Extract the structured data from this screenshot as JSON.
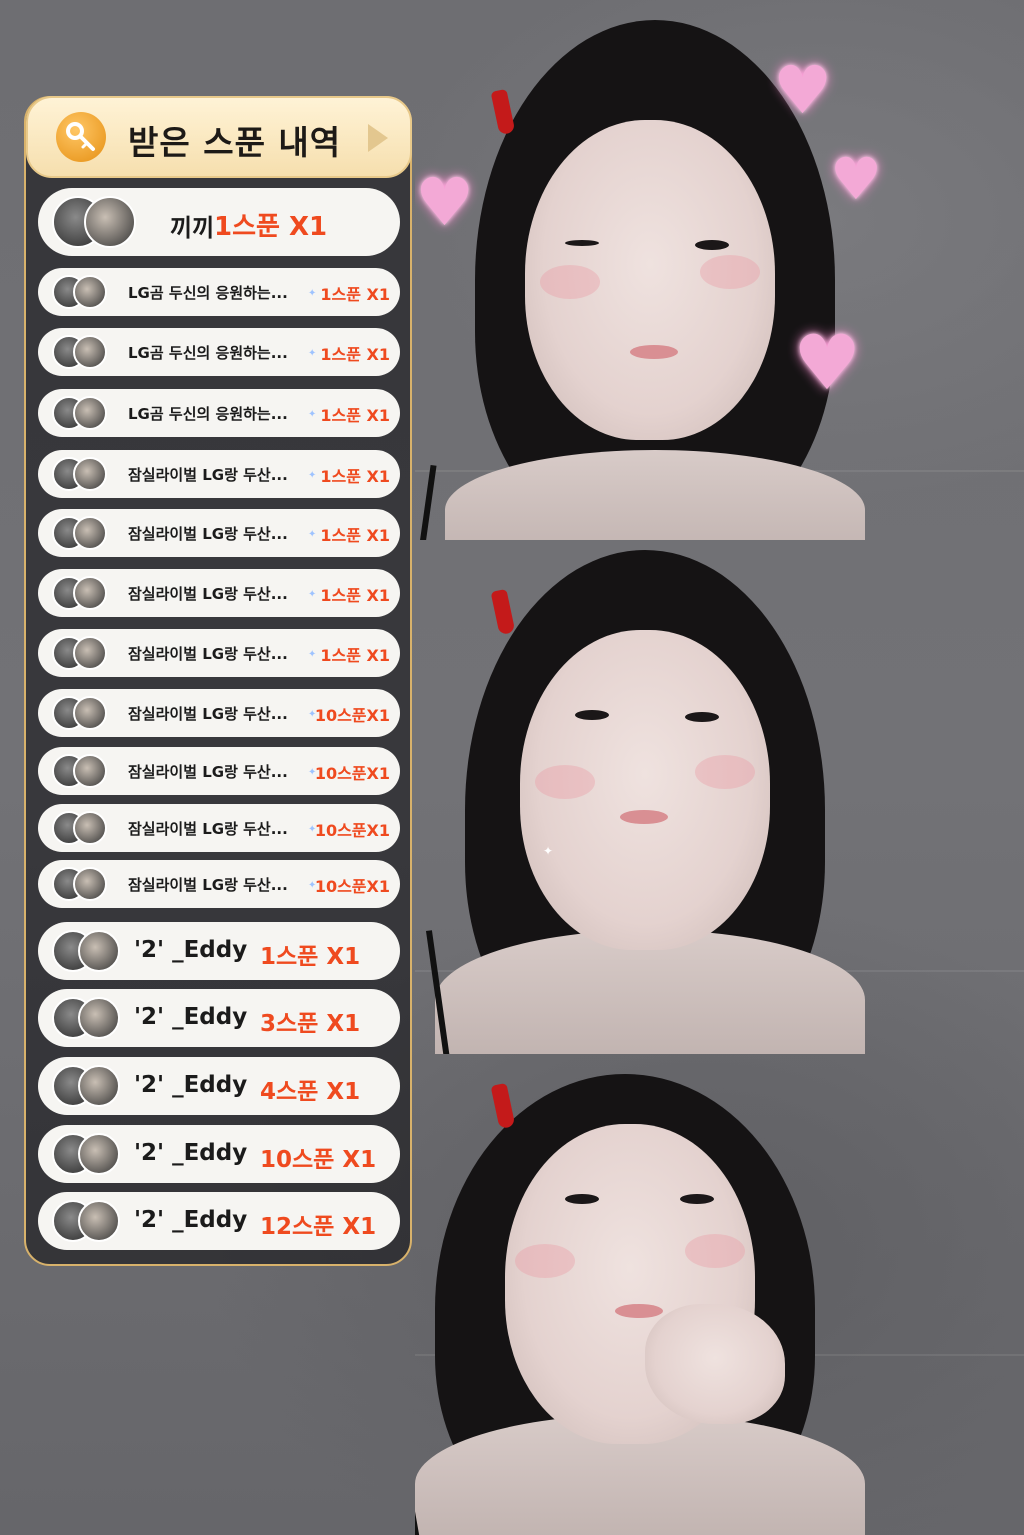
{
  "panel": {
    "title": "받은 스푼 내역",
    "icon": "key-icon",
    "accent": "#d8b26b",
    "gift_color": "#ef4a1f"
  },
  "rows": [
    {
      "name": "끼끼",
      "gift": "1스푼 X1"
    },
    {
      "name": "LG곰 두신의 응원하는...",
      "gift": "1스푼 X1"
    },
    {
      "name": "LG곰 두신의 응원하는...",
      "gift": "1스푼 X1"
    },
    {
      "name": "LG곰 두신의 응원하는...",
      "gift": "1스푼 X1"
    },
    {
      "name": "잠실라이벌 LG랑 두산...",
      "gift": "1스푼 X1"
    },
    {
      "name": "잠실라이벌 LG랑 두산...",
      "gift": "1스푼 X1"
    },
    {
      "name": "잠실라이벌 LG랑 두산...",
      "gift": "1스푼 X1"
    },
    {
      "name": "잠실라이벌 LG랑 두산...",
      "gift": "1스푼 X1"
    },
    {
      "name": "잠실라이벌 LG랑 두산...",
      "gift": "10스푼X1"
    },
    {
      "name": "잠실라이벌 LG랑 두산...",
      "gift": "10스푼X1"
    },
    {
      "name": "잠실라이벌 LG랑 두산...",
      "gift": "10스푼X1"
    },
    {
      "name": "잠실라이벌 LG랑 두산...",
      "gift": "10스푼X1"
    },
    {
      "name": "'2' _Eddy",
      "gift": "1스푼 X1"
    },
    {
      "name": "'2' _Eddy",
      "gift": "3스푼 X1"
    },
    {
      "name": "'2' _Eddy",
      "gift": "4스푼 X1"
    },
    {
      "name": "'2' _Eddy",
      "gift": "10스푼 X1"
    },
    {
      "name": "'2' _Eddy",
      "gift": "12스푼 X1"
    }
  ]
}
